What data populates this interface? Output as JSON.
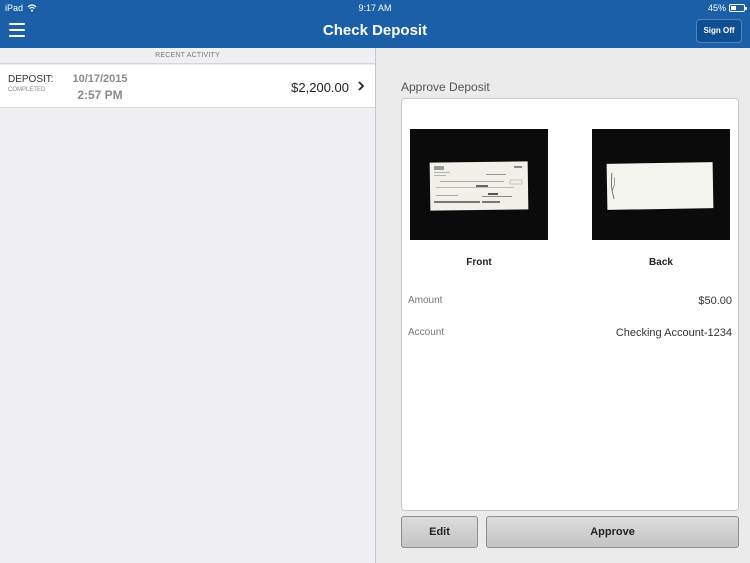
{
  "status_bar": {
    "device": "iPad",
    "time": "9:17 AM",
    "battery": "45%",
    "battery_level": 0.45
  },
  "header": {
    "title": "Check Deposit",
    "signoff_label": "Sign Off",
    "menu_icon": "hamburger-menu-icon"
  },
  "colors": {
    "header_bg": "#1b5fa8",
    "panel_bg": "#ebebeb",
    "button_bg": "#d0d0d0"
  },
  "recent_activity": {
    "section_label": "RECENT ACTIVITY",
    "items": [
      {
        "type": "DEPOSIT:",
        "status": "COMPLETED",
        "date": "10/17/2015",
        "time": "2:57 PM",
        "amount": "$2,200.00"
      }
    ]
  },
  "approve": {
    "title": "Approve Deposit",
    "front_label": "Front",
    "back_label": "Back",
    "fields": [
      {
        "label": "Amount",
        "value": "$50.00"
      },
      {
        "label": "Account",
        "value": "Checking Account-1234"
      }
    ],
    "edit_label": "Edit",
    "approve_label": "Approve"
  }
}
